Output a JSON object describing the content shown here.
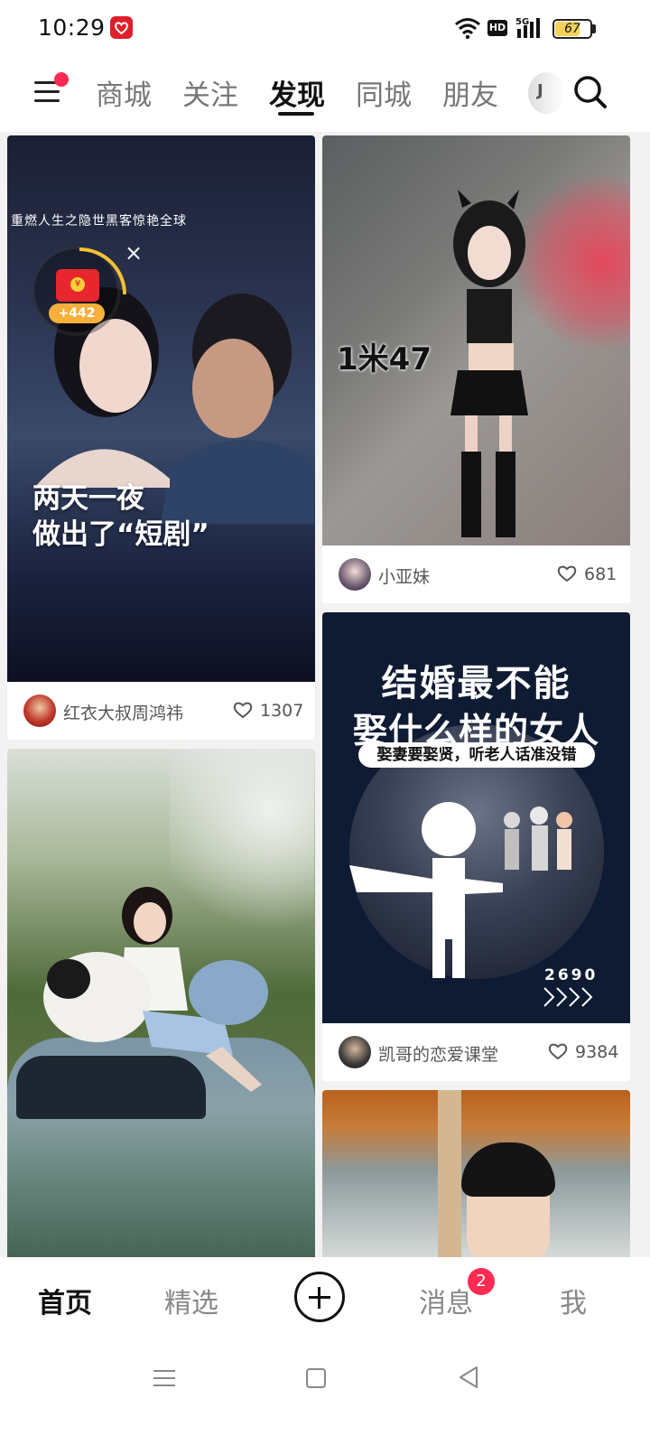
{
  "status_bar": {
    "time": "10:29",
    "battery": "67",
    "hd_label": "HD",
    "network_label": "5G",
    "icons": [
      "app-notification-icon",
      "wifi-icon",
      "hd-icon",
      "signal-icon",
      "battery-icon"
    ]
  },
  "top_nav": {
    "tabs": [
      {
        "label": "商城"
      },
      {
        "label": "关注"
      },
      {
        "label": "发现"
      },
      {
        "label": "同城"
      },
      {
        "label": "朋友"
      }
    ],
    "active_tab": "发现",
    "more_label": "J",
    "icons": [
      "menu-icon",
      "search-icon"
    ]
  },
  "feed": {
    "cards": [
      {
        "overlay_title": "重燃人生之隐世黑客惊艳全球",
        "overlay_text_line1": "两天一夜",
        "overlay_text_line2": "做出了“短剧”",
        "red_packet_amount": "+442",
        "close_label": "×",
        "author": "红衣大叔周鸿祎",
        "likes": "1307"
      },
      {
        "overlay_text": "1米47",
        "author": "小亚妹",
        "likes": "681"
      },
      {
        "title_line1": "结婚最不能",
        "title_line2": "娶什么样的女人",
        "subtitle": "娶妻要娶贤，听老人话准没错",
        "number": "2690",
        "author": "凯哥的恋爱课堂",
        "likes": "9384"
      },
      {},
      {}
    ],
    "accent_color": "#ff2b52"
  },
  "bottom_nav": {
    "items": [
      {
        "label": "首页"
      },
      {
        "label": "精选"
      },
      {
        "label": "消息"
      },
      {
        "label": "我"
      }
    ],
    "active": "首页",
    "message_badge": "2"
  }
}
